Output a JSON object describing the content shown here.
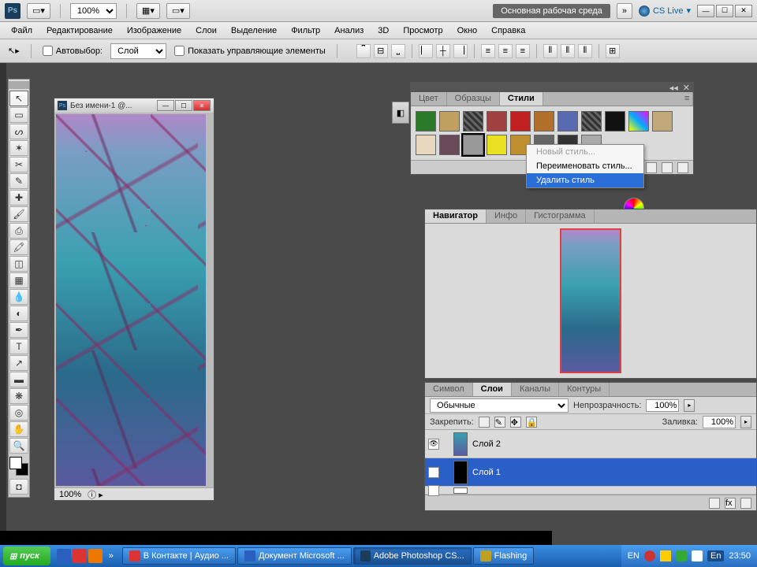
{
  "header": {
    "zoom": "100%",
    "workspace": "Основная рабочая среда",
    "cslive": "CS Live"
  },
  "menu": [
    "Файл",
    "Редактирование",
    "Изображение",
    "Слои",
    "Выделение",
    "Фильтр",
    "Анализ",
    "3D",
    "Просмотр",
    "Окно",
    "Справка"
  ],
  "options": {
    "auto_select_label": "Автовыбор:",
    "auto_select_value": "Слой",
    "show_controls_label": "Показать управляющие элементы"
  },
  "document": {
    "title": "Без имени-1 @...",
    "status_zoom": "100%"
  },
  "styles_panel": {
    "tabs": [
      "Цвет",
      "Образцы",
      "Стили"
    ],
    "active_tab": 2,
    "swatches": [
      {
        "bg": "#2a7a2a"
      },
      {
        "bg": "#c0a060"
      },
      {
        "bg": "#222",
        "pat": true
      },
      {
        "bg": "#a04040"
      },
      {
        "bg": "#c02020"
      },
      {
        "bg": "#b0702a"
      },
      {
        "bg": "#5a6ab0"
      },
      {
        "bg": "#888",
        "pat": true
      },
      {
        "bg": "#111"
      },
      {
        "bg": "linear-gradient(45deg,#ff0,#0af,#f0f)"
      },
      {
        "bg": "#c0a878"
      },
      {
        "bg": "#e8d8c0"
      },
      {
        "bg": "#6a4a5a"
      },
      {
        "bg": "#999",
        "sel": true
      },
      {
        "bg": "#e8e020"
      },
      {
        "bg": "#c09030"
      },
      {
        "bg": "#666"
      },
      {
        "bg": "#333"
      },
      {
        "bg": "#aaa"
      }
    ],
    "context_menu": {
      "new_style": "Новый стиль...",
      "rename_style": "Переименовать стиль...",
      "delete_style": "Удалить стиль"
    }
  },
  "navigator": {
    "tabs": [
      "Навигатор",
      "Инфо",
      "Гистограмма"
    ],
    "active_tab": 0
  },
  "layers_panel": {
    "tabs": [
      "Символ",
      "Слои",
      "Каналы",
      "Контуры"
    ],
    "active_tab": 1,
    "blend_mode": "Обычные",
    "opacity_label": "Непрозрачность:",
    "opacity_value": "100%",
    "lock_label": "Закрепить:",
    "fill_label": "Заливка:",
    "fill_value": "100%",
    "layers": [
      {
        "name": "Слой 2",
        "selected": false
      },
      {
        "name": "Слой 1",
        "selected": true
      }
    ]
  },
  "taskbar": {
    "start": "пуск",
    "tasks": [
      {
        "label": "В Контакте | Аудио ...",
        "icon": "#d33"
      },
      {
        "label": "Документ Microsoft ...",
        "icon": "#2a5fc0"
      },
      {
        "label": "Adobe Photoshop CS...",
        "icon": "#1a3d5c",
        "active": true
      },
      {
        "label": "Flashing",
        "icon": "#c0a020"
      }
    ],
    "lang": "EN",
    "lang2": "En",
    "time": "23:50"
  }
}
